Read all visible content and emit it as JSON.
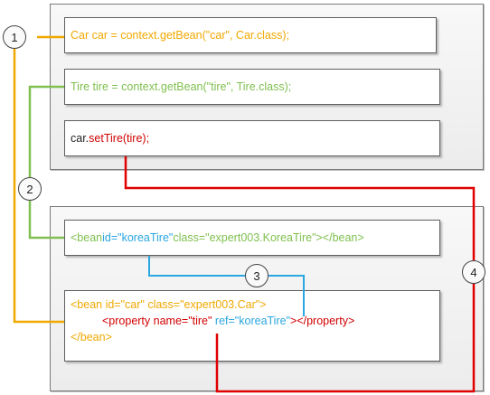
{
  "java": {
    "line1": "Car car = context.getBean(\"car\", Car.class);",
    "line2": "Tire tire = context.getBean(\"tire\", Tire.class);",
    "line3": {
      "obj": "car.",
      "call": "setTire(tire);"
    }
  },
  "xml": {
    "bean_tire": {
      "open": "<bean ",
      "id_attr": "id=\"koreaTire\"",
      "rest": " class=\"expert003.KoreaTire\"></bean>"
    },
    "bean_car": {
      "line1": "<bean id=\"car\" class=\"expert003.Car\">",
      "prop_open": "<property name=\"tire\" ",
      "prop_ref": "ref=\"koreaTire\"",
      "prop_close": "></property>",
      "line3": "</bean>"
    }
  },
  "callouts": [
    "1",
    "2",
    "3",
    "4"
  ],
  "colors": {
    "yellow": "#f0a800",
    "green": "#80c050",
    "blue": "#2aa6e0",
    "red": "#d00000"
  }
}
